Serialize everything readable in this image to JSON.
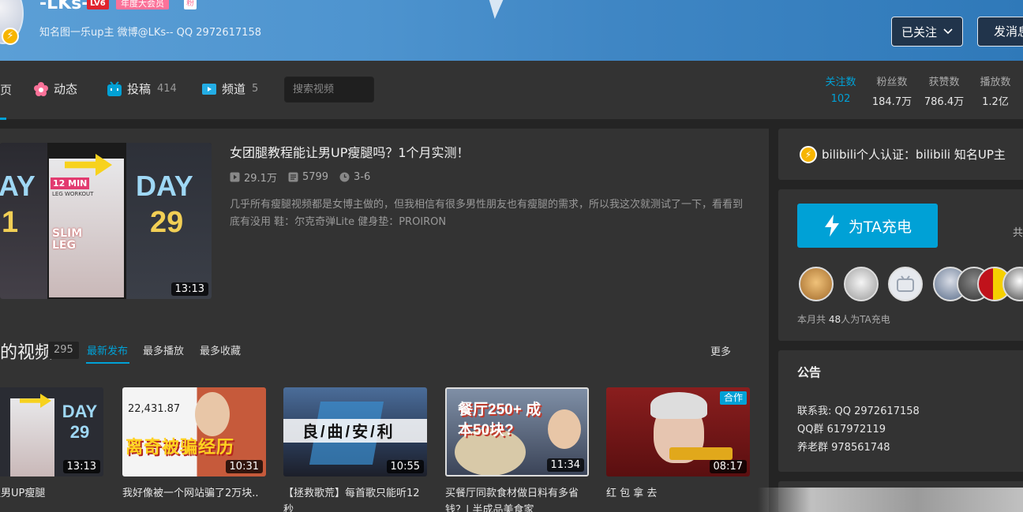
{
  "header": {
    "username": "-LKs-",
    "level": "LV6",
    "vip": "年度大会员",
    "fan_tag": "粉",
    "signature": "知名图一乐up主 微博@LKs-- QQ 2972617158",
    "follow_label": "已关注",
    "message_label": "发消息"
  },
  "nav": {
    "home": "页",
    "items": [
      {
        "label": "动态",
        "count": ""
      },
      {
        "label": "投稿",
        "count": "414"
      },
      {
        "label": "频道",
        "count": "5"
      }
    ],
    "search_placeholder": "搜索视频",
    "stats": [
      {
        "label": "关注数",
        "value": "102"
      },
      {
        "label": "粉丝数",
        "value": "184.7万"
      },
      {
        "label": "获赞数",
        "value": "786.4万"
      },
      {
        "label": "播放数",
        "value": "1.2亿"
      }
    ]
  },
  "featured": {
    "title": "女团腿教程能让男UP瘦腿吗？1个月实测！",
    "plays": "29.1万",
    "danmaku": "5799",
    "date": "3-6",
    "description": "几乎所有瘦腿视频都是女博主做的，但我相信有很多男性朋友也有瘦腿的需求，所以我这次就测试了一下，看看到底有没用 鞋：尔克奇弹Lite 健身垫：PROIRON",
    "duration": "13:13",
    "thumb_text": {
      "day": "DAY",
      "day_left": "AY",
      "num_left": "1",
      "num_right": "29",
      "min": "12 MIN",
      "workout": "LEG WORKOUT",
      "slim": "SLIM",
      "leg": "LEG"
    }
  },
  "videos_section": {
    "title": "的视频",
    "count": "295",
    "tabs": [
      "最新发布",
      "最多播放",
      "最多收藏"
    ],
    "more": "更多",
    "videos": [
      {
        "title": "教程能让男UP瘦腿\n月实测！",
        "duration": "13:13",
        "thumb_text": "DAY 29"
      },
      {
        "title": "我好像被一个网站骗了2万块..",
        "duration": "10:31",
        "thumb_text": "离奇被骗经历",
        "thumb_number": "22,431.87"
      },
      {
        "title": "【拯救歌荒】每首歌只能听12\n秒",
        "duration": "10:55",
        "thumb_text": "良/曲/安/利"
      },
      {
        "title": "买餐厅同款食材做日料有多省\n钱？| 半成品美食家",
        "duration": "11:34",
        "thumb_text": "餐厅250+ 成本50块?"
      },
      {
        "title": "红 包 拿 去",
        "duration": "08:17",
        "badge": "合作"
      }
    ]
  },
  "sidebar": {
    "certification": "bilibili个人认证：bilibili 知名UP主",
    "charge_label": "为TA充电",
    "charge_share": "共",
    "charge_note_prefix": "本月共 ",
    "charge_count": "48",
    "charge_note_suffix": "人为TA充电",
    "notice_title": "公告",
    "notice_lines": "联系我: QQ 2972617158\nQQ群 617972119\n养老群 978561748"
  },
  "colors": {
    "accent": "#00a1d6",
    "pink": "#fb7299",
    "bg": "#242424",
    "panel": "#333333"
  }
}
